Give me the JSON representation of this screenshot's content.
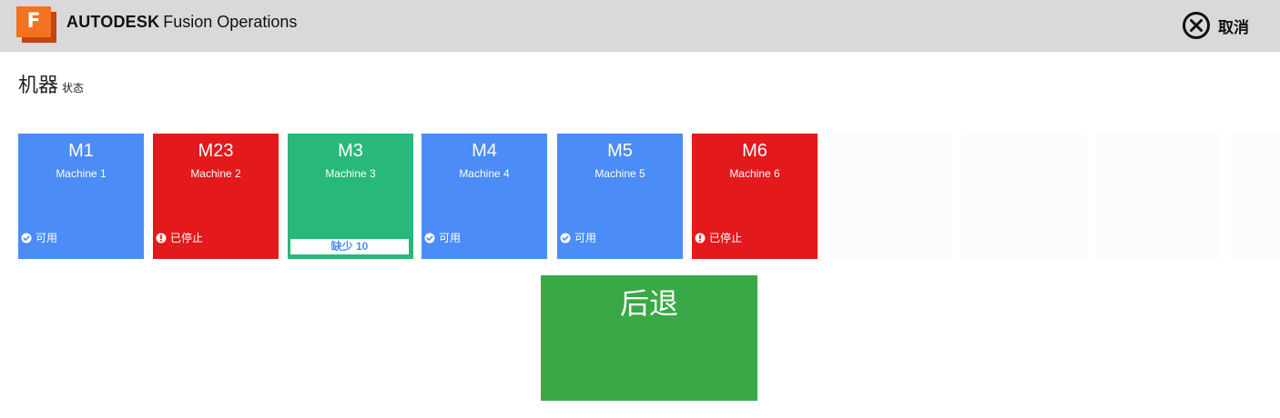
{
  "header": {
    "logo_letter": "F",
    "brand_bold": "AUTODESK",
    "brand_product": "Fusion Operations",
    "cancel_label": "取消",
    "cancel_icon": "close-circle-icon",
    "logo_color": "#f37321"
  },
  "page": {
    "title": "机器",
    "subtitle": "状态"
  },
  "machines": [
    {
      "code": "M1",
      "name": "Machine 1",
      "status": "可用",
      "status_icon": "check-circle-icon",
      "color": "#4b8cf7"
    },
    {
      "code": "M23",
      "name": "Machine 2",
      "status": "已停止",
      "status_icon": "alert-circle-icon",
      "color": "#e3191b"
    },
    {
      "code": "M3",
      "name": "Machine 3",
      "shortage": "缺少 10",
      "color": "#27b87a"
    },
    {
      "code": "M4",
      "name": "Machine 4",
      "status": "可用",
      "status_icon": "check-circle-icon",
      "color": "#4b8cf7"
    },
    {
      "code": "M5",
      "name": "Machine 5",
      "status": "可用",
      "status_icon": "check-circle-icon",
      "color": "#4b8cf7"
    },
    {
      "code": "M6",
      "name": "Machine 6",
      "status": "已停止",
      "status_icon": "alert-circle-icon",
      "color": "#e3191b"
    }
  ],
  "back": {
    "label": "后退",
    "color": "#38a946"
  }
}
